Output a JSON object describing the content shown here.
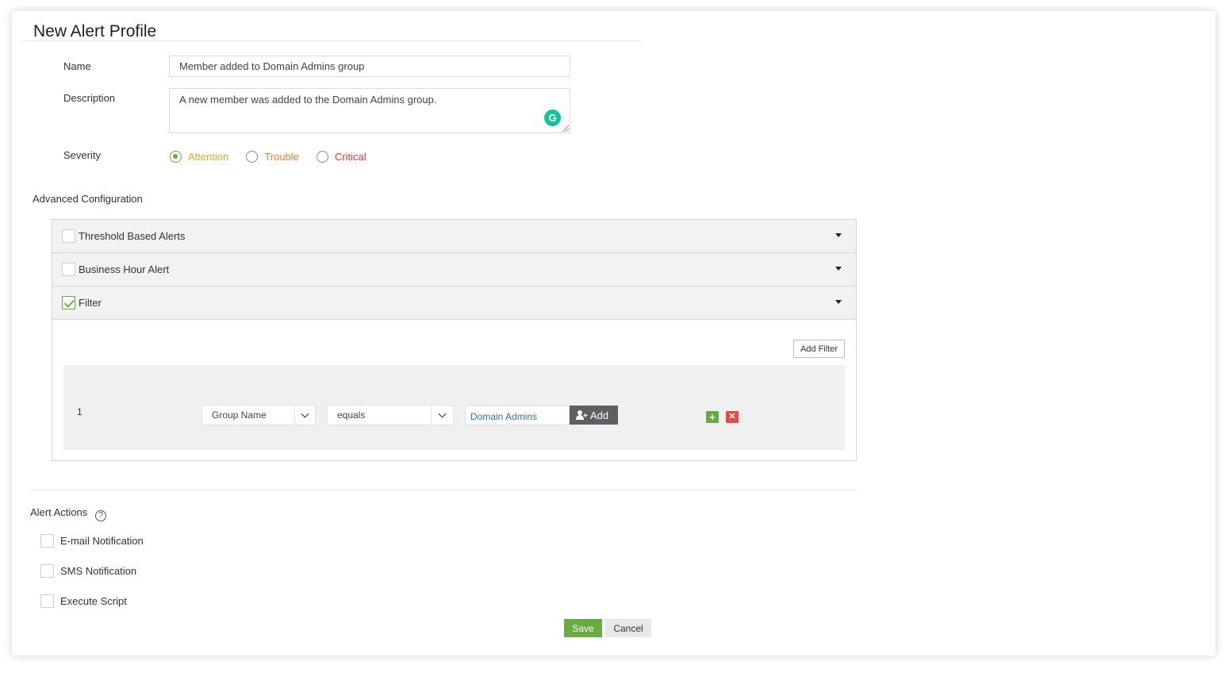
{
  "page": {
    "title": "New Alert Profile"
  },
  "form": {
    "name_label": "Name",
    "name_value": "Member added to Domain Admins group",
    "description_label": "Description",
    "description_value": "A new member was added to the Domain Admins group.",
    "severity_label": "Severity",
    "severity_options": [
      {
        "label": "Attention",
        "color": "#e9a526",
        "selected": true
      },
      {
        "label": "Trouble",
        "color": "#f07b3f",
        "selected": false
      },
      {
        "label": "Critical",
        "color": "#d9383a",
        "selected": false
      }
    ]
  },
  "advanced": {
    "heading": "Advanced Configuration",
    "sections": [
      {
        "label": "Threshold Based Alerts",
        "checked": false
      },
      {
        "label": "Business Hour Alert",
        "checked": false
      },
      {
        "label": "Filter",
        "checked": true
      }
    ],
    "add_filter_label": "Add Filter",
    "filter_rows": [
      {
        "index": "1",
        "field": "Group Name",
        "operator": "equals",
        "value": "Domain Admins",
        "add_label": "Add"
      }
    ]
  },
  "alert_actions": {
    "heading": "Alert Actions",
    "help_icon": "?",
    "items": [
      {
        "label": "E-mail Notification",
        "checked": false
      },
      {
        "label": "SMS Notification",
        "checked": false
      },
      {
        "label": "Execute Script",
        "checked": false
      }
    ]
  },
  "buttons": {
    "save": "Save",
    "cancel": "Cancel"
  },
  "colors": {
    "accent_green": "#6aaa43",
    "delete_red": "#e04b4b",
    "link_blue": "#2f6fb2"
  }
}
